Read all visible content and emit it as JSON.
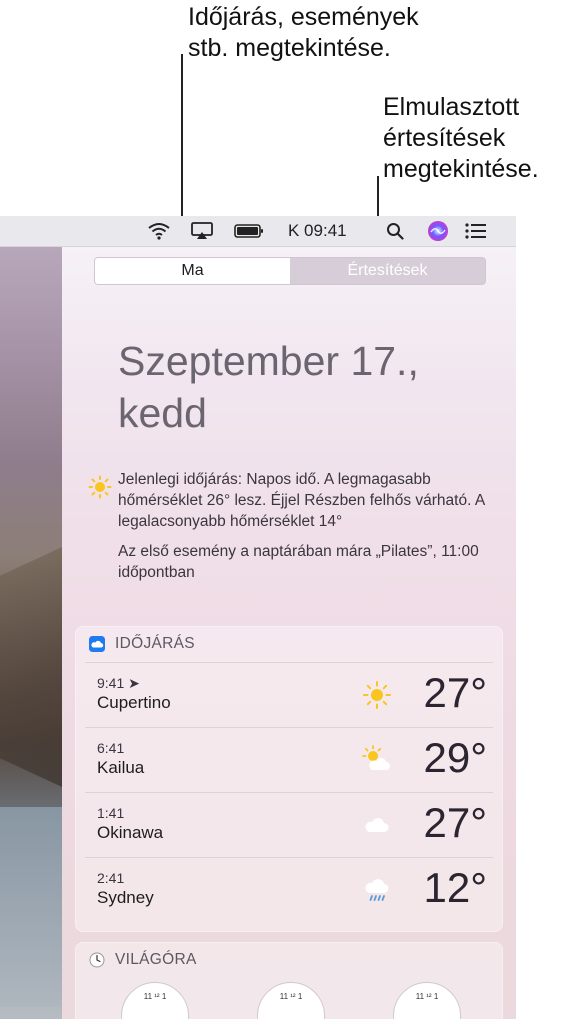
{
  "callouts": {
    "today_line1": "Időjárás, események",
    "today_line2": "stb. megtekintése.",
    "notif_line1": "Elmulasztott",
    "notif_line2": "értesítések",
    "notif_line3": "megtekintése."
  },
  "menubar": {
    "icons": [
      "wifi-icon",
      "airplay-icon",
      "battery-icon",
      "search-icon",
      "siri-icon",
      "notification-center-icon"
    ],
    "clock": "K 09:41"
  },
  "tabs": {
    "today": "Ma",
    "notifications": "Értesítések",
    "selected": "today"
  },
  "today": {
    "date_line1": "Szeptember 17.,",
    "date_line2": "kedd",
    "summary_weather": "Jelenlegi időjárás: Napos idő. A legmagasabb hőmérséklet 26° lesz. Éjjel Részben felhős várható. A legalacsonyabb hőmérséklet 14°",
    "summary_event": "Az első esemény a naptárában mára „Pilates”, 11:00 időpontban"
  },
  "weather_widget": {
    "title": "IDŐJÁRÁS",
    "rows": [
      {
        "time": "9:41 ➤",
        "city": "Cupertino",
        "icon": "sun-icon",
        "temp": "27°"
      },
      {
        "time": "6:41",
        "city": "Kailua",
        "icon": "partly-cloudy-icon",
        "temp": "29°"
      },
      {
        "time": "1:41",
        "city": "Okinawa",
        "icon": "cloud-icon",
        "temp": "27°"
      },
      {
        "time": "2:41",
        "city": "Sydney",
        "icon": "rain-icon",
        "temp": "12°"
      }
    ]
  },
  "world_clock_widget": {
    "title": "VILÁGÓRA"
  },
  "colors": {
    "accent_blue": "#1a73e8",
    "panel_tint": "#efdbe4"
  }
}
